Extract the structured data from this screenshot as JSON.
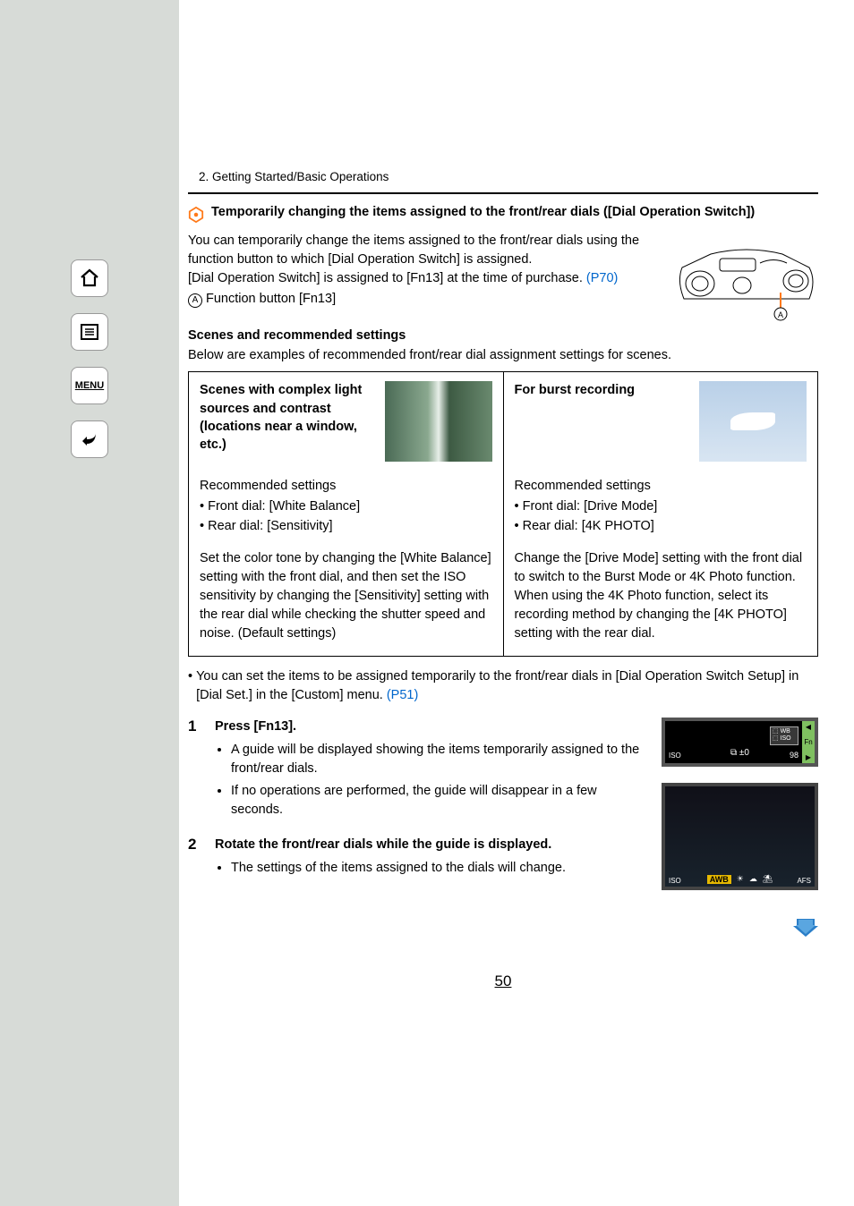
{
  "sidebar": {
    "menu_label": "MENU"
  },
  "chapter": "2. Getting Started/Basic Operations",
  "section_title": "Temporarily changing the items assigned to the front/rear dials ([Dial Operation Switch])",
  "intro": {
    "p1": "You can temporarily change the items assigned to the front/rear dials using the function button to which [Dial Operation Switch] is assigned.",
    "p2a": "[Dial Operation Switch] is assigned to [Fn13] at the time of purchase. ",
    "p2_link": "(P70)",
    "label_a": "A",
    "label_a_text": "Function button [Fn13]"
  },
  "scenes_heading": "Scenes and recommended settings",
  "scenes_line": "Below are examples of recommended front/rear dial assignment settings for scenes.",
  "col_left": {
    "title": "Scenes with complex light sources and contrast (locations near a window, etc.)",
    "rec_heading": "Recommended settings",
    "rec1": "• Front dial: [White Balance]",
    "rec2": "• Rear dial: [Sensitivity]",
    "desc": "Set the color tone by changing the [White Balance] setting with the front dial, and then set the ISO sensitivity by changing the [Sensitivity] setting with the rear dial while checking the shutter speed and noise. (Default settings)"
  },
  "col_right": {
    "title": "For burst recording",
    "rec_heading": "Recommended settings",
    "rec1": "• Front dial: [Drive Mode]",
    "rec2": "• Rear dial: [4K PHOTO]",
    "desc": "Change the [Drive Mode] setting with the front dial to switch to the Burst Mode or 4K Photo function. When using the 4K Photo function, select its recording method by changing the [4K PHOTO] setting with the rear dial."
  },
  "note": {
    "text_a": "You can set the items to be assigned temporarily to the front/rear dials in [Dial Operation Switch Setup] in [Dial Set.] in the [Custom] menu. ",
    "link": "(P51)"
  },
  "step1": {
    "num": "1",
    "title": "Press [Fn13].",
    "b1": "A guide will be displayed showing the items temporarily assigned to the front/rear dials.",
    "b2": "If no operations are performed, the guide will disappear in a few seconds."
  },
  "step2": {
    "num": "2",
    "title": "Rotate the front/rear dials while the guide is displayed.",
    "b1": "The settings of the items assigned to the dials will change."
  },
  "lcd1": {
    "exp": "±0",
    "exp_icon": "⧉",
    "iso_top": "WB",
    "iso_bot": "ISO",
    "fn": "Fn",
    "iso_l": "ISO",
    "count": "98"
  },
  "lcd2": {
    "awb": "AWB",
    "corner_l": "ISO",
    "corner_r": "AFS"
  },
  "page_number": "50"
}
